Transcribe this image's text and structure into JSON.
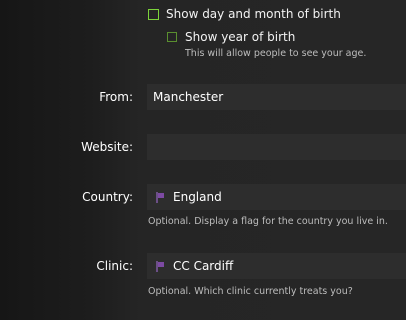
{
  "checkboxes": {
    "day_month": {
      "label": "Show day and month of birth"
    },
    "year": {
      "label": "Show year of birth",
      "hint": "This will allow people to see your age."
    }
  },
  "fields": {
    "from": {
      "label": "From:",
      "value": "Manchester"
    },
    "website": {
      "label": "Website:",
      "value": ""
    },
    "country": {
      "label": "Country:",
      "value": "England",
      "icon": "flag-icon",
      "hint": "Optional. Display a flag for the country you live in."
    },
    "clinic": {
      "label": "Clinic:",
      "value": "CC Cardiff",
      "icon": "flag-icon",
      "hint": "Optional. Which clinic currently treats you?"
    }
  },
  "colors": {
    "checkbox_border": "#7cd33b",
    "flag": "#7d4aa3"
  }
}
